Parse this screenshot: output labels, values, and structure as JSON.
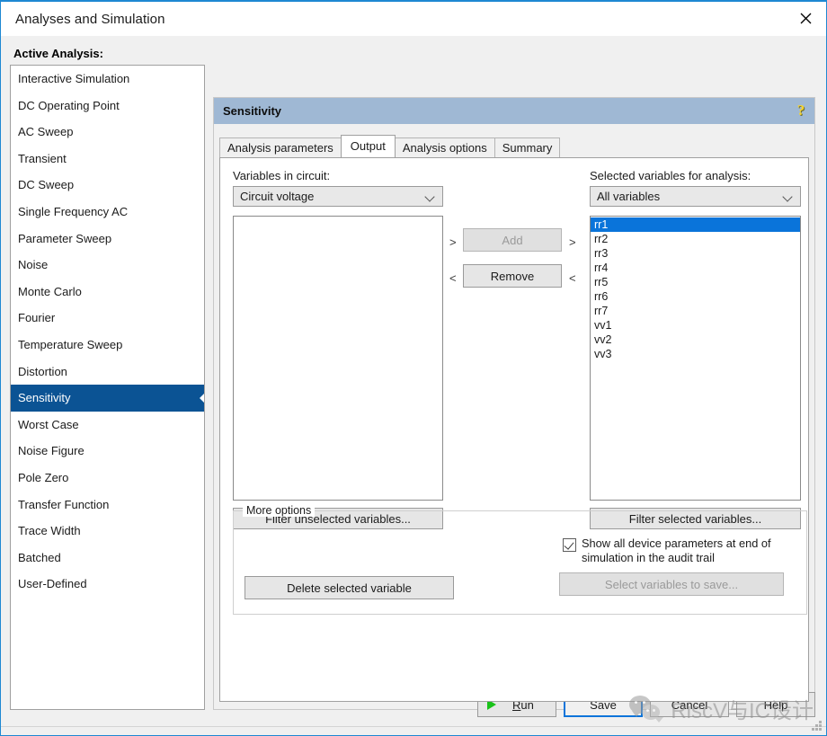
{
  "window": {
    "title": "Analyses and Simulation",
    "close_icon": "close-icon"
  },
  "active_analysis": {
    "label": "Active Analysis:",
    "selected": "Sensitivity",
    "items": [
      "Interactive Simulation",
      "DC Operating Point",
      "AC Sweep",
      "Transient",
      "DC Sweep",
      "Single Frequency AC",
      "Parameter Sweep",
      "Noise",
      "Monte Carlo",
      "Fourier",
      "Temperature Sweep",
      "Distortion",
      "Sensitivity",
      "Worst Case",
      "Noise Figure",
      "Pole Zero",
      "Transfer Function",
      "Trace Width",
      "Batched",
      "User-Defined"
    ]
  },
  "panel": {
    "title": "Sensitivity",
    "help_icon": "question-mark-icon",
    "header_color": "#9fb8d4"
  },
  "tabs": [
    {
      "label": "Analysis parameters",
      "active": false
    },
    {
      "label": "Output",
      "active": true
    },
    {
      "label": "Analysis options",
      "active": false
    },
    {
      "label": "Summary",
      "active": false
    }
  ],
  "output_tab": {
    "left": {
      "label": "Variables in circuit:",
      "combo_value": "Circuit voltage",
      "list_items": [],
      "filter_button": "Filter unselected variables..."
    },
    "right": {
      "label": "Selected variables for analysis:",
      "combo_value": "All variables",
      "list_items": [
        "rr1",
        "rr2",
        "rr3",
        "rr4",
        "rr5",
        "rr6",
        "rr7",
        "vv1",
        "vv2",
        "vv3"
      ],
      "selected_item": "rr1",
      "filter_button": "Filter selected variables..."
    },
    "transfer": {
      "add_label": "Add",
      "remove_label": "Remove",
      "add_left_arrow": ">",
      "add_right_arrow": ">",
      "remove_left_arrow": "<",
      "remove_right_arrow": "<"
    },
    "more_options": {
      "legend": "More options",
      "delete_button": "Delete selected variable",
      "checkbox_label": "Show all device parameters at end of simulation in the audit trail",
      "checkbox_checked": true,
      "select_variables_button": "Select variables to save..."
    }
  },
  "footer": {
    "run_label": "Run",
    "run_accel": "R",
    "run_rest": "un",
    "save_label": "Save",
    "cancel_label": "Cancel",
    "help_label": "Help"
  },
  "watermark": {
    "text": "RiscV与IC设计",
    "logo": "wechat-icon"
  },
  "colors": {
    "accent": "#0a74da",
    "selection": "#0b5394",
    "panel_header": "#9fb8d4",
    "window_border": "#1e88d2"
  }
}
